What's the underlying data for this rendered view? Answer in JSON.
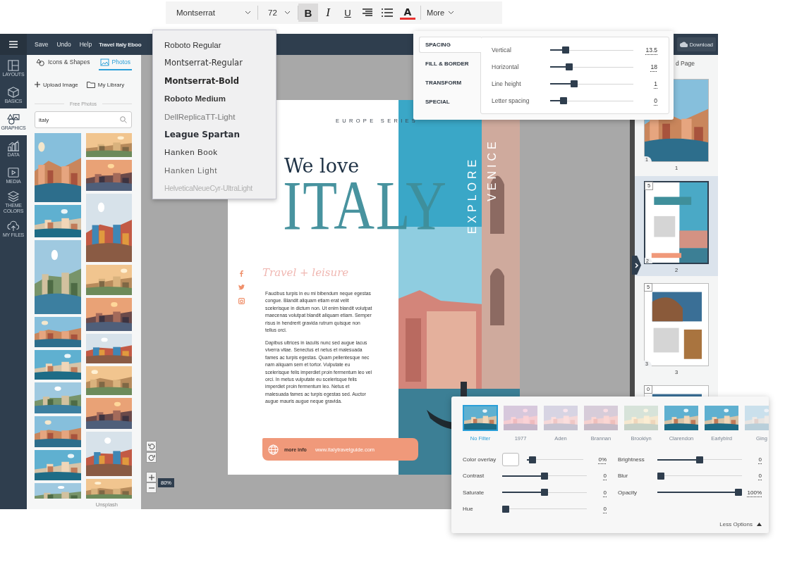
{
  "toolbar": {
    "font": "Montserrat",
    "size": "72",
    "tools": [
      {
        "kind": "bold",
        "label": "B",
        "selected": true
      },
      {
        "kind": "italic",
        "label": "I",
        "selected": false
      },
      {
        "kind": "underline",
        "label": "U",
        "selected": false
      },
      {
        "kind": "align",
        "selected": false
      },
      {
        "kind": "list",
        "selected": false
      }
    ],
    "text_color": {
      "label": "A",
      "color": "#e8312f"
    },
    "more": "More"
  },
  "font_menu": [
    {
      "label": "Roboto Regular",
      "kind": "regular"
    },
    {
      "label": "Montserrat-Regular",
      "kind": "wide"
    },
    {
      "label": "Montserrat-Bold",
      "kind": "wide-bold"
    },
    {
      "label": "Roboto Medium",
      "kind": "medium"
    },
    {
      "label": "DellReplicaTT-Light",
      "kind": "light"
    },
    {
      "label": "League Spartan",
      "kind": "heavy"
    },
    {
      "label": "Hanken Book",
      "kind": "book"
    },
    {
      "label": "Hanken Light",
      "kind": "book-light"
    },
    {
      "label": "HelveticaNeueCyr-UltraLight",
      "kind": "thin"
    }
  ],
  "top_bar": {
    "menu": [
      "Save",
      "Undo",
      "Help"
    ],
    "title": "Travel Italy Eboo",
    "download": "Download"
  },
  "rail": [
    {
      "kind": "layouts",
      "label": "LAYOUTS",
      "selected": false
    },
    {
      "kind": "basics",
      "label": "BASICS",
      "selected": false
    },
    {
      "kind": "graphics",
      "label": "GRAPHICS",
      "selected": true
    },
    {
      "kind": "data",
      "label": "DATA",
      "selected": false
    },
    {
      "kind": "media",
      "label": "MEDIA",
      "selected": false
    },
    {
      "kind": "theme",
      "label": "THEME COLORS",
      "selected": false
    },
    {
      "kind": "files",
      "label": "MY FILES",
      "selected": false
    }
  ],
  "left_panel": {
    "tabs": [
      {
        "kind": "shapes",
        "label": "Icons & Shapes",
        "selected": false
      },
      {
        "kind": "photos",
        "label": "Photos",
        "selected": true
      }
    ],
    "upload": "Upload Image",
    "library": "My Library",
    "section": "Free Photos",
    "search": {
      "value": "italy"
    },
    "credit": "Unsplash"
  },
  "spacing_panel": {
    "tabs": [
      {
        "label": "SPACING",
        "selected": true
      },
      {
        "label": "FILL & BORDER",
        "selected": false
      },
      {
        "label": "TRANSFORM",
        "selected": false
      },
      {
        "label": "SPECIAL",
        "selected": false
      }
    ],
    "rows": [
      {
        "label": "Vertical",
        "level": 0.16,
        "reading": "13.5"
      },
      {
        "label": "Horizontal",
        "level": 0.2,
        "reading": "18"
      },
      {
        "label": "Line height",
        "level": 0.27,
        "reading": "1"
      },
      {
        "label": "Letter spacing",
        "level": 0.13,
        "reading": "0"
      }
    ]
  },
  "document": {
    "series": "EUROPE SERIES",
    "headline": "We love",
    "title": "ITALY",
    "vertical": [
      "EXPLORE",
      "VENICE"
    ],
    "subtitle": "Travel + leisure",
    "paragraphs": [
      "Faucibus turpis in eu mi bibendum neque egestas congue. Blandit aliquam etiam erat velit scelerisque in dictum non. Ut enim blandit volutpat maecenas volutpat blandit aliquam etiam. Semper risus in hendrerit gravida rutrum quisque non tellus orci.",
      "Dapibus ultrices in iaculis nunc sed augue lacus viverra vitae. Senectus et netus et malesuada fames ac turpis egestas. Quam pellentesque nec nam aliquam sem et tortor. Vulputate eu scelerisque felis imperdiet proin fermentum leo vel orci. In metus vulputate eu scelerisque felis imperdiet proin fermentum leo. Netus et malesuada fames ac turpis egestas sed. Auctor augue mauris augue neque gravida."
    ],
    "cta": {
      "label": "more info",
      "url": "www.italytravelguide.com"
    }
  },
  "canvas": {
    "zoom": "80%"
  },
  "pages_panel": {
    "add": "d Page",
    "pages": [
      {
        "number": "1",
        "corner": "1",
        "selected": false
      },
      {
        "badge": "5",
        "number": "2",
        "corner": "2",
        "selected": true
      },
      {
        "badge": "5",
        "number": "3",
        "corner": "3",
        "selected": false
      },
      {
        "badge": "0",
        "selected": false
      }
    ]
  },
  "filter_panel": {
    "filters": [
      {
        "label": "No Filter",
        "selected": true
      },
      {
        "label": "1977",
        "selected": false
      },
      {
        "label": "Aden",
        "selected": false
      },
      {
        "label": "Brannan",
        "selected": false
      },
      {
        "label": "Brooklyn",
        "selected": false
      },
      {
        "label": "Clarendon",
        "selected": false
      },
      {
        "label": "Earlybird",
        "selected": false
      },
      {
        "label": "Ging",
        "selected": false
      }
    ],
    "left": [
      {
        "kind": "overlay",
        "label": "Color overlay",
        "level": 0.04,
        "reading": "0%"
      },
      {
        "kind": "slider",
        "label": "Contrast",
        "level": 0.5,
        "reading": "0"
      },
      {
        "kind": "slider",
        "label": "Saturate",
        "level": 0.5,
        "reading": "0"
      },
      {
        "kind": "slider",
        "label": "Hue",
        "level": 0,
        "reading": "0"
      }
    ],
    "right": [
      {
        "kind": "slider",
        "label": "Brightness",
        "level": 0.5,
        "reading": "0"
      },
      {
        "kind": "slider",
        "label": "Blur",
        "level": 0,
        "reading": "0"
      },
      {
        "kind": "slider",
        "label": "Opacity",
        "level": 1,
        "reading": "100%"
      }
    ],
    "toggle": "Less Options"
  }
}
